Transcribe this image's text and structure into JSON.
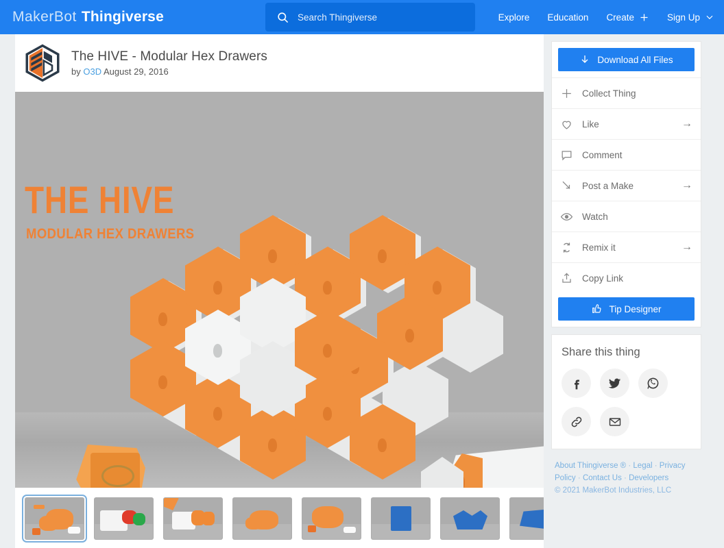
{
  "header": {
    "logo_primary": "MakerBot",
    "logo_secondary": "Thingiverse",
    "search": {
      "icon": "search-icon",
      "placeholder": "Search Thingiverse",
      "value": ""
    },
    "nav": [
      {
        "label": "Explore",
        "icon": ""
      },
      {
        "label": "Education",
        "icon": ""
      },
      {
        "label": "Create",
        "icon": "plus-icon"
      },
      {
        "label": "Sign Up",
        "icon": "chevron-down-icon"
      }
    ],
    "bg_color": "#2080f0"
  },
  "thing": {
    "title": "The HIVE - Modular Hex Drawers",
    "by_label": "by",
    "author": "O3D",
    "date": "August 29, 2016",
    "avatar_icon": "hex-3d-logo-icon",
    "hero": {
      "title": "THE HIVE",
      "subtitle": "MODULAR HEX DRAWERS",
      "accent_color": "#ef8235",
      "background_color": "#b0b0b0"
    }
  },
  "thumbnails": [
    {
      "label": "hive-render-orange-front",
      "selected": true
    },
    {
      "label": "drawers-red-green-photo",
      "selected": false
    },
    {
      "label": "hex-drawers-orange-photo",
      "selected": false
    },
    {
      "label": "hive-render-angled",
      "selected": false
    },
    {
      "label": "hive-render-orange-side",
      "selected": false
    },
    {
      "label": "blue-drawer-render",
      "selected": false
    },
    {
      "label": "blue-hex-open-render",
      "selected": false
    },
    {
      "label": "blue-part-render",
      "selected": false
    }
  ],
  "sidebar": {
    "download_button": {
      "label": "Download All Files",
      "icon": "download-arrow-icon"
    },
    "actions": [
      {
        "label": "Collect Thing",
        "icon": "plus-icon",
        "has_arrow": false
      },
      {
        "label": "Like",
        "icon": "heart-icon",
        "has_arrow": true
      },
      {
        "label": "Comment",
        "icon": "comment-icon",
        "has_arrow": false
      },
      {
        "label": "Post a Make",
        "icon": "post-make-icon",
        "has_arrow": true
      },
      {
        "label": "Watch",
        "icon": "eye-icon",
        "has_arrow": false
      },
      {
        "label": "Remix it",
        "icon": "remix-refresh-icon",
        "has_arrow": true
      },
      {
        "label": "Copy Link",
        "icon": "upload-link-icon",
        "has_arrow": false
      }
    ],
    "tip_button": {
      "label": "Tip Designer",
      "icon": "thumbs-up-icon"
    },
    "share": {
      "heading": "Share this thing",
      "buttons": [
        {
          "label": "Facebook",
          "icon": "facebook-icon"
        },
        {
          "label": "Twitter",
          "icon": "twitter-icon"
        },
        {
          "label": "WhatsApp",
          "icon": "whatsapp-icon"
        },
        {
          "label": "Copy link",
          "icon": "chain-link-icon"
        },
        {
          "label": "Email",
          "icon": "envelope-icon"
        }
      ]
    },
    "accent_color": "#2080f0"
  },
  "footer": {
    "links": [
      "About Thingiverse ®",
      "Legal",
      "Privacy Policy",
      "Contact Us",
      "Developers"
    ],
    "copyright": "© 2021 MakerBot Industries, LLC"
  }
}
